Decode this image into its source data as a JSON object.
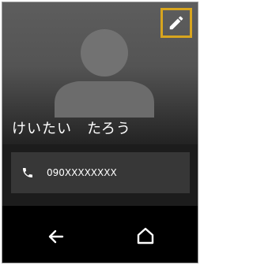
{
  "contact": {
    "name": "けいたい　たろう",
    "phone_number": "090XXXXXXXX"
  },
  "icons": {
    "edit": "pencil-icon",
    "phone": "phone-icon",
    "avatar": "person-avatar-icon",
    "back": "back-arrow-icon",
    "home": "home-icon"
  },
  "colors": {
    "highlight_frame": "#d8a51e",
    "header_top": "#5d5d5d",
    "phone_card": "#373737",
    "nav_bar": "#000000"
  }
}
